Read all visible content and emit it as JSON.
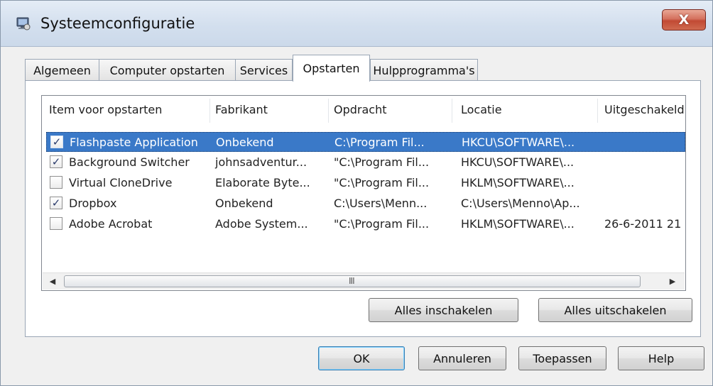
{
  "window": {
    "title": "Systeemconfiguratie",
    "close_symbol": "X"
  },
  "tabs": [
    {
      "label": "Algemeen"
    },
    {
      "label": "Computer opstarten"
    },
    {
      "label": "Services"
    },
    {
      "label": "Opstarten",
      "active": true
    },
    {
      "label": "Hulpprogramma's"
    }
  ],
  "list": {
    "columns": [
      "Item voor opstarten",
      "Fabrikant",
      "Opdracht",
      "Locatie",
      "Uitgeschakeld"
    ],
    "rows": [
      {
        "checked": true,
        "selected": true,
        "item": "Flashpaste Application",
        "fabrikant": "Onbekend",
        "opdracht": "C:\\Program Fil...",
        "locatie": "HKCU\\SOFTWARE\\...",
        "uitgeschakeld": ""
      },
      {
        "checked": true,
        "selected": false,
        "item": "Background Switcher",
        "fabrikant": "johnsadventur...",
        "opdracht": "\"C:\\Program Fil...",
        "locatie": "HKCU\\SOFTWARE\\...",
        "uitgeschakeld": ""
      },
      {
        "checked": false,
        "selected": false,
        "item": "Virtual CloneDrive",
        "fabrikant": "Elaborate Byte...",
        "opdracht": "\"C:\\Program Fil...",
        "locatie": "HKLM\\SOFTWARE\\...",
        "uitgeschakeld": ""
      },
      {
        "checked": true,
        "selected": false,
        "item": "Dropbox",
        "fabrikant": "Onbekend",
        "opdracht": "C:\\Users\\Menn...",
        "locatie": "C:\\Users\\Menno\\Ap...",
        "uitgeschakeld": ""
      },
      {
        "checked": false,
        "selected": false,
        "item": "Adobe Acrobat",
        "fabrikant": "Adobe System...",
        "opdracht": "\"C:\\Program Fil...",
        "locatie": "HKLM\\SOFTWARE\\...",
        "uitgeschakeld": "26-6-2011 21"
      }
    ],
    "scroll_grip": "III"
  },
  "panel_buttons": {
    "enable_all": "Alles inschakelen",
    "disable_all": "Alles uitschakelen"
  },
  "footer_buttons": {
    "ok": "OK",
    "cancel": "Annuleren",
    "apply": "Toepassen",
    "help": "Help"
  },
  "icons": {
    "app": "msconfig-icon",
    "close": "close-icon",
    "check": "checkmark-icon",
    "scroll_left": "scroll-left-arrow-icon",
    "scroll_right": "scroll-right-arrow-icon"
  },
  "colors": {
    "selection": "#3a79c8",
    "close_button": "#c24a34",
    "titlebar": "#d3dfee"
  }
}
